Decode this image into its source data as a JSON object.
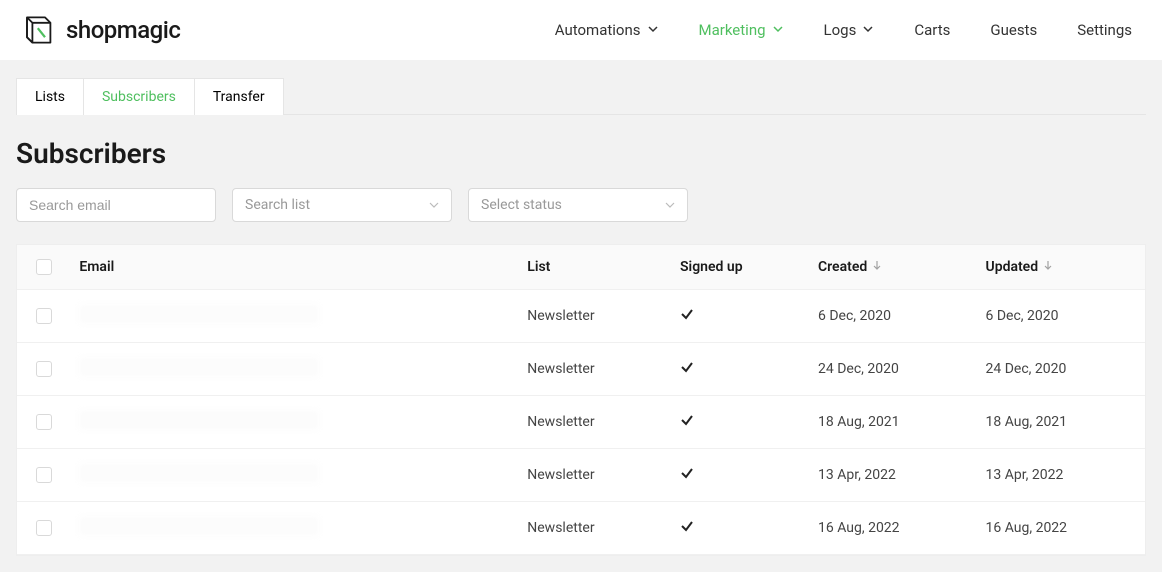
{
  "brand": "shopmagic",
  "nav": {
    "automations": "Automations",
    "marketing": "Marketing",
    "logs": "Logs",
    "carts": "Carts",
    "guests": "Guests",
    "settings": "Settings"
  },
  "tabs": {
    "lists": "Lists",
    "subscribers": "Subscribers",
    "transfer": "Transfer"
  },
  "page_title": "Subscribers",
  "filters": {
    "search_email_placeholder": "Search email",
    "search_list_placeholder": "Search list",
    "select_status_placeholder": "Select status"
  },
  "table": {
    "columns": {
      "email": "Email",
      "list": "List",
      "signed_up": "Signed up",
      "created": "Created",
      "updated": "Updated"
    },
    "rows": [
      {
        "list": "Newsletter",
        "signed_up": true,
        "created": "6 Dec, 2020",
        "updated": "6 Dec, 2020"
      },
      {
        "list": "Newsletter",
        "signed_up": true,
        "created": "24 Dec, 2020",
        "updated": "24 Dec, 2020"
      },
      {
        "list": "Newsletter",
        "signed_up": true,
        "created": "18 Aug, 2021",
        "updated": "18 Aug, 2021"
      },
      {
        "list": "Newsletter",
        "signed_up": true,
        "created": "13 Apr, 2022",
        "updated": "13 Apr, 2022"
      },
      {
        "list": "Newsletter",
        "signed_up": true,
        "created": "16 Aug, 2022",
        "updated": "16 Aug, 2022"
      }
    ]
  }
}
